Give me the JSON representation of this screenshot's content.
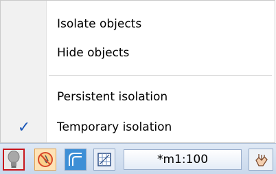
{
  "menu": {
    "items": [
      {
        "label": "Isolate objects",
        "checked": false
      },
      {
        "label": "Hide objects",
        "checked": false
      },
      {
        "label": "Persistent isolation",
        "checked": false
      },
      {
        "label": "Temporary isolation",
        "checked": true
      }
    ],
    "check_glyph": "✓"
  },
  "statusbar": {
    "buttons": [
      {
        "icon": "lightbulb-icon",
        "active": true
      },
      {
        "icon": "no-isolate-icon",
        "active": false
      },
      {
        "icon": "snap-icon",
        "active": false
      },
      {
        "icon": "grid-icon",
        "active": false
      }
    ],
    "annotation_scale": "*m1:100",
    "pan_icon": "hand-pan-icon"
  },
  "colors": {
    "accent": "#1a57b8",
    "active_border": "#c8141b"
  }
}
